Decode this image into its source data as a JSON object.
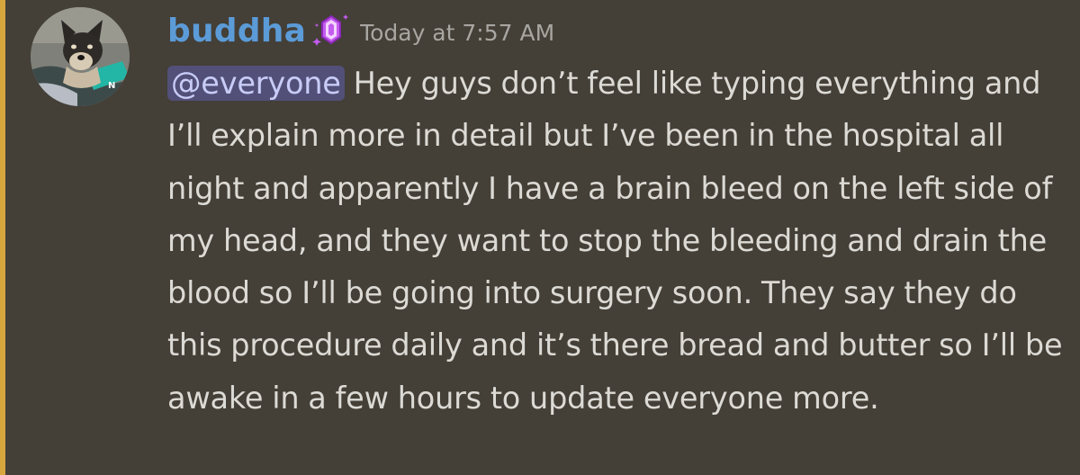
{
  "message": {
    "author": "buddha",
    "timestamp": "Today at 7:57 AM",
    "mention": "@everyone",
    "text": " Hey guys don’t feel like typing everything and I’ll explain more in detail but I’ve been in the hospital all night and apparently I have a brain bleed on the left side of my head, and they want to stop the bleeding and drain the blood so I’ll be going into surgery soon. They say they do this procedure daily and it’s there bread and butter so I’ll be awake in a few hours to update everyone more.",
    "avatar_icon": "dog-avatar",
    "badge_icon": "crystal-badge-icon"
  },
  "colors": {
    "background": "#443f37",
    "highlight_bar": "#d7a63c",
    "username": "#5b9bd8",
    "mention_bg": "#525078",
    "mention_text": "#c8ccf7",
    "text": "#dcdad4",
    "timestamp": "#a8a6a1"
  }
}
